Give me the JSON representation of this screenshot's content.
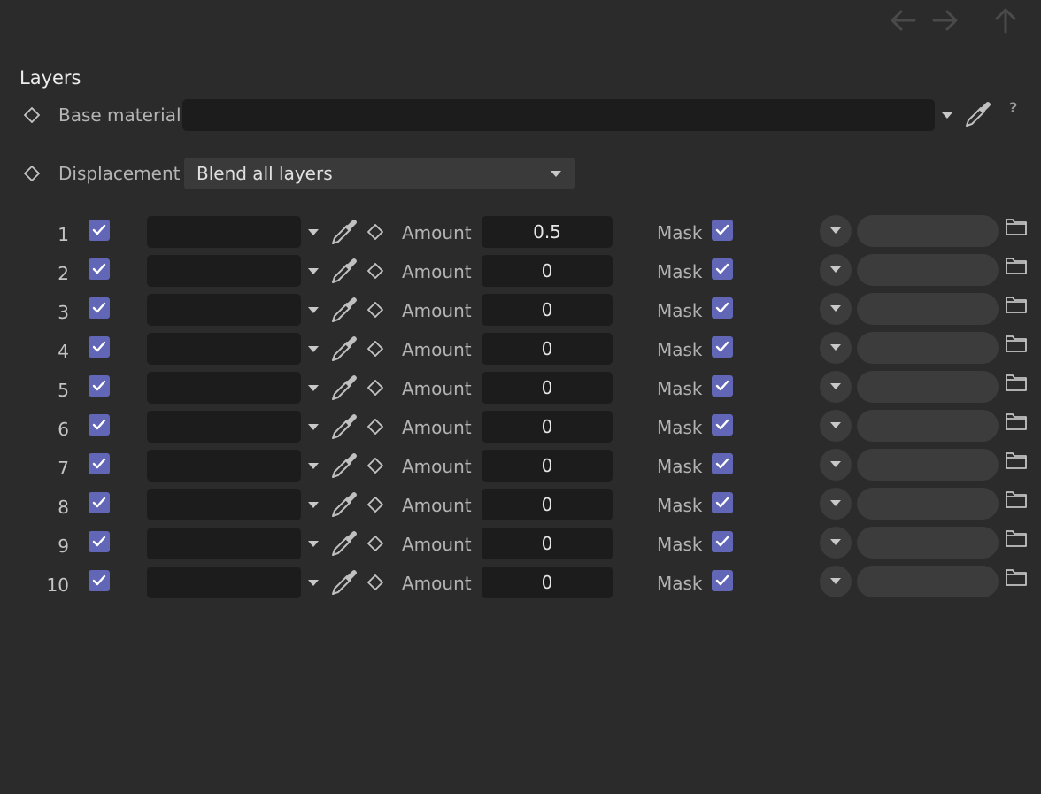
{
  "nav": {
    "back_icon": "arrow-left-icon",
    "forward_icon": "arrow-right-icon",
    "up_icon": "arrow-up-icon"
  },
  "section": {
    "title": "Layers",
    "help_label": "?"
  },
  "base_material": {
    "label": "Base material",
    "value": ""
  },
  "displacement": {
    "label": "Displacement",
    "value": "Blend all layers"
  },
  "colors": {
    "background": "#2b2b2b",
    "checkbox": "#6266b6",
    "field_dark": "#1c1c1c"
  },
  "layers": [
    {
      "index": "1",
      "amount_label": "Amount",
      "amount": "0.5",
      "mask_label": "Mask",
      "enabled": true,
      "mask_enabled": true
    },
    {
      "index": "2",
      "amount_label": "Amount",
      "amount": "0",
      "mask_label": "Mask",
      "enabled": true,
      "mask_enabled": true
    },
    {
      "index": "3",
      "amount_label": "Amount",
      "amount": "0",
      "mask_label": "Mask",
      "enabled": true,
      "mask_enabled": true
    },
    {
      "index": "4",
      "amount_label": "Amount",
      "amount": "0",
      "mask_label": "Mask",
      "enabled": true,
      "mask_enabled": true
    },
    {
      "index": "5",
      "amount_label": "Amount",
      "amount": "0",
      "mask_label": "Mask",
      "enabled": true,
      "mask_enabled": true
    },
    {
      "index": "6",
      "amount_label": "Amount",
      "amount": "0",
      "mask_label": "Mask",
      "enabled": true,
      "mask_enabled": true
    },
    {
      "index": "7",
      "amount_label": "Amount",
      "amount": "0",
      "mask_label": "Mask",
      "enabled": true,
      "mask_enabled": true
    },
    {
      "index": "8",
      "amount_label": "Amount",
      "amount": "0",
      "mask_label": "Mask",
      "enabled": true,
      "mask_enabled": true
    },
    {
      "index": "9",
      "amount_label": "Amount",
      "amount": "0",
      "mask_label": "Mask",
      "enabled": true,
      "mask_enabled": true
    },
    {
      "index": "10",
      "amount_label": "Amount",
      "amount": "0",
      "mask_label": "Mask",
      "enabled": true,
      "mask_enabled": true
    }
  ]
}
